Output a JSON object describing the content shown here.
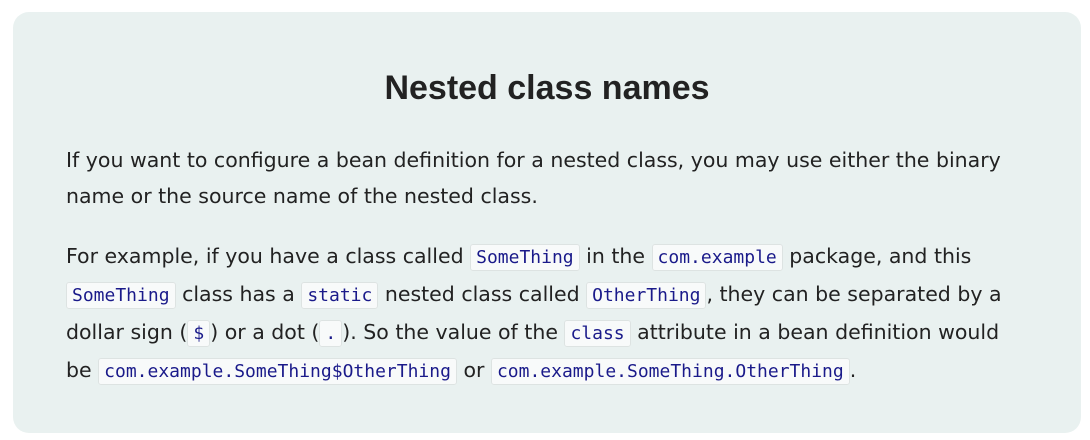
{
  "title": "Nested class names",
  "para1": "If you want to configure a bean definition for a nested class, you may use either the binary name or the source name of the nested class.",
  "para2": {
    "t1": "For example, if you have a class called ",
    "c1": "SomeThing",
    "t2": " in the ",
    "c2": "com.example",
    "t3": " package, and this ",
    "c3": "SomeThing",
    "t4": " class has a ",
    "c4": "static",
    "t5": " nested class called ",
    "c5": "OtherThing",
    "t6": ", they can be separated by a dollar sign (",
    "c6": "$",
    "t7": ") or a dot (",
    "c7": ".",
    "t8": "). So the value of the ",
    "c8": "class",
    "t9": " attribute in a bean definition would be ",
    "c9": "com.example.SomeThing$OtherThing",
    "t10": " or ",
    "c10": "com.example.SomeThing.OtherThing",
    "t11": "."
  }
}
